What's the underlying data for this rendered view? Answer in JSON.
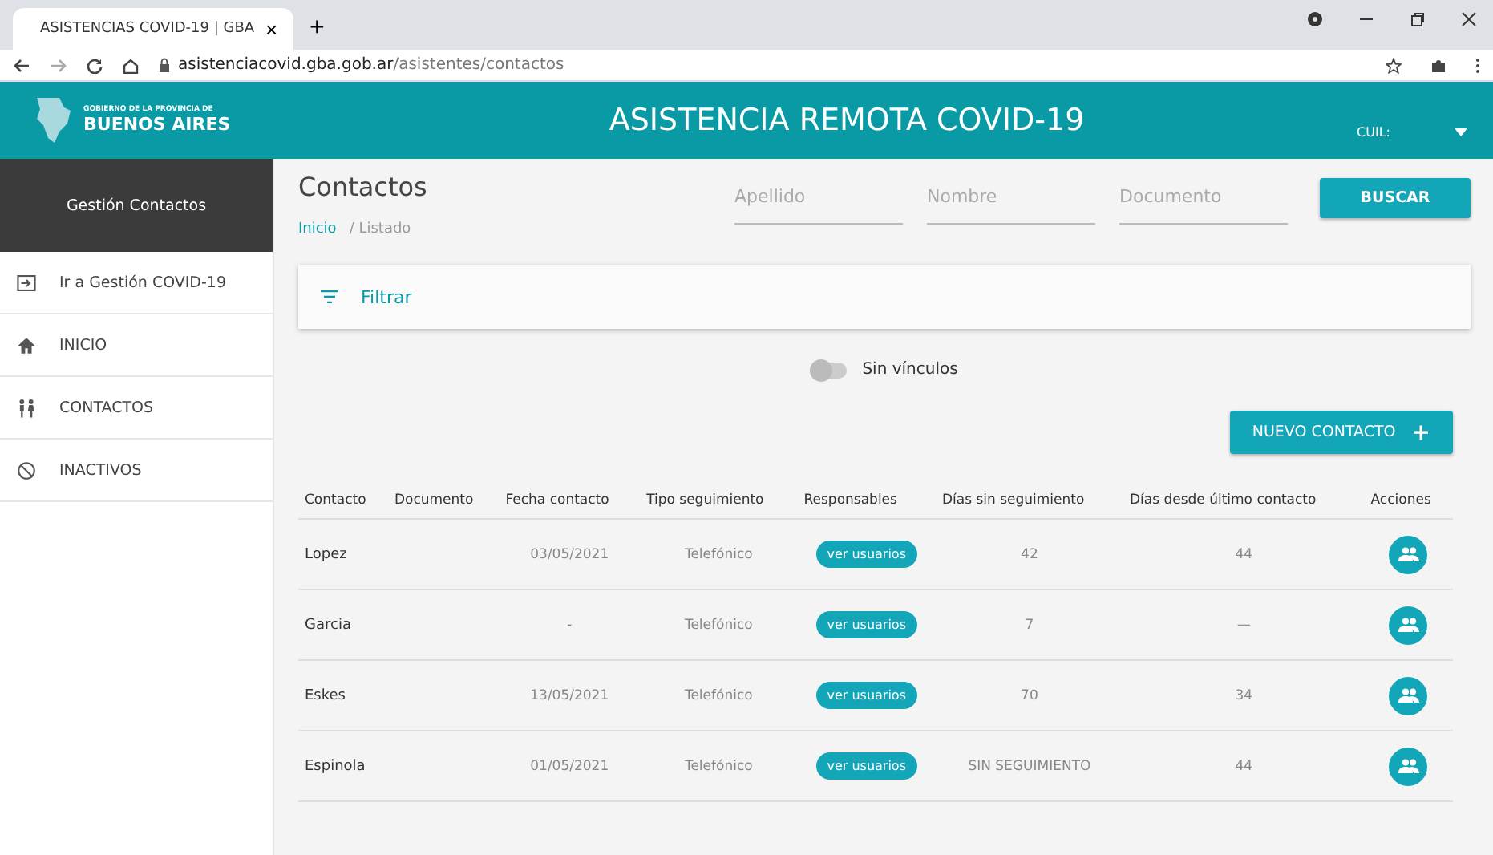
{
  "browser": {
    "tab_title": "ASISTENCIAS COVID-19 | GBA",
    "tab_close": "×",
    "new_tab": "+",
    "url_host": "asistenciacovid.gba.gob.ar",
    "url_path": "/asistentes/contactos"
  },
  "header": {
    "logo_small": "GOBIERNO DE LA PROVINCIA DE",
    "logo_big": "BUENOS AIRES",
    "title": "ASISTENCIA REMOTA COVID-19",
    "user_label": "CUIL:"
  },
  "sidebar": {
    "title": "Gestión Contactos",
    "items": [
      {
        "label": "Ir a Gestión COVID-19",
        "kind": "exit",
        "selected": false
      },
      {
        "label": "INICIO",
        "kind": "home",
        "selected": false
      },
      {
        "label": "CONTACTOS",
        "kind": "people",
        "selected": false
      },
      {
        "label": "INACTIVOS",
        "kind": "block",
        "selected": false
      }
    ]
  },
  "page": {
    "title": "Contactos",
    "breadcrumb": [
      {
        "label": "Inicio",
        "link": true
      },
      {
        "label": "/ Listado",
        "link": false
      }
    ]
  },
  "search": {
    "fields": [
      {
        "placeholder": "Apellido"
      },
      {
        "placeholder": "Nombre"
      },
      {
        "placeholder": "Documento"
      }
    ],
    "button": "BUSCAR"
  },
  "filter": {
    "label": "Filtrar"
  },
  "toggle": {
    "label": "Sin vínculos",
    "on": false
  },
  "new_button": {
    "label": "NUEVO CONTACTO",
    "icon": "+"
  },
  "table": {
    "columns": [
      "Contacto",
      "Documento",
      "Fecha contacto",
      "Tipo seguimiento",
      "Responsables",
      "Días sin seguimiento",
      "Días desde último contacto",
      "Acciones"
    ],
    "rows": [
      {
        "contacto": "Lopez",
        "fecha": "03/05/2021",
        "tipo": "Telefónico",
        "responsables": "ver usuarios",
        "dias_sin": "42",
        "dias_desde": "44"
      },
      {
        "contacto": "Garcia",
        "fecha": "-",
        "tipo": "Telefónico",
        "responsables": "ver usuarios",
        "dias_sin": "7",
        "dias_desde": "—"
      },
      {
        "contacto": "Eskes",
        "fecha": "13/05/2021",
        "tipo": "Telefónico",
        "responsables": "ver usuarios",
        "dias_sin": "70",
        "dias_desde": "34"
      },
      {
        "contacto": "Espinola",
        "fecha": "01/05/2021",
        "tipo": "Telefónico",
        "responsables": "ver usuarios",
        "dias_sin": "SIN SEGUIMIENTO",
        "dias_desde": "44"
      }
    ]
  }
}
